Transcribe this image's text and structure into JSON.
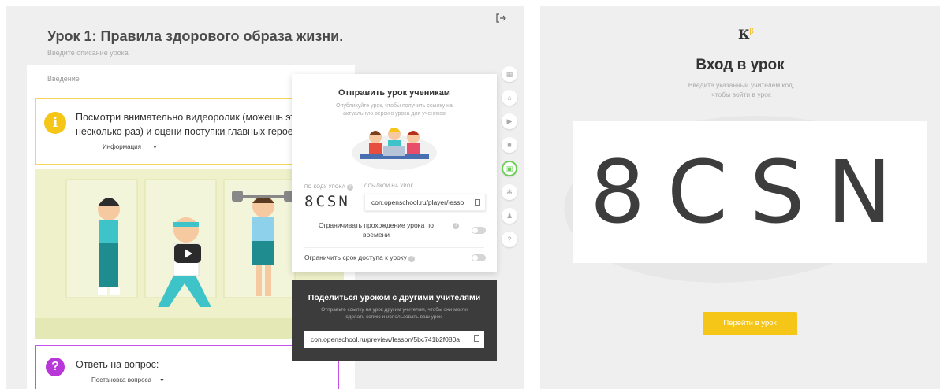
{
  "editor": {
    "logout_icon": "logout-icon",
    "lesson_title": "Урок 1: Правила здорового образа жизни.",
    "lesson_description_placeholder": "Введите описание урока",
    "section_label": "Введение",
    "info_card": {
      "icon": "i",
      "line1": "Посмотри внимательно видеоролик (можешь это сде",
      "line2": "несколько раз) и оцени поступки главных героев.",
      "type": "Информация"
    },
    "question_card": {
      "icon": "?",
      "text": "Ответь на вопрос:",
      "type": "Постановка вопроса"
    },
    "share": {
      "title": "Отправить урок ученикам",
      "subtitle": "Опубликуйте урок, чтобы получить ссылку на актуальную версию урока для учеников",
      "code_label": "ПО КОДУ УРОКА",
      "link_label": "ССЫЛКОЙ НА УРОК",
      "code": "8CSN",
      "link": "con.openschool.ru/player/lesso",
      "limit_time": "Ограничивать прохождение урока по времени",
      "limit_access": "Ограничить срок доступа к уроку"
    },
    "teachers": {
      "title": "Поделиться уроком с другими учителями",
      "subtitle": "Отправьте ссылку на урок другим учителям, чтобы они могли сделать копию и использовать ваш урок.",
      "link": "con.openschool.ru/preview/lesson/5bc741b2f080a"
    },
    "toolbar": [
      "grid-icon",
      "home-icon",
      "play-icon",
      "book-icon",
      "share-icon",
      "settings-icon",
      "users-icon",
      "help-icon"
    ]
  },
  "login": {
    "logo": "К",
    "logo_sup": "β",
    "title": "Вход в урок",
    "subtitle": "Введите указанный учителем код, чтобы войти в урок",
    "code": "8CSN",
    "button": "Перейти в урок"
  },
  "colors": {
    "accent_yellow": "#f5c518",
    "accent_purple": "#b936d8",
    "accent_green": "#6dcf5a"
  }
}
